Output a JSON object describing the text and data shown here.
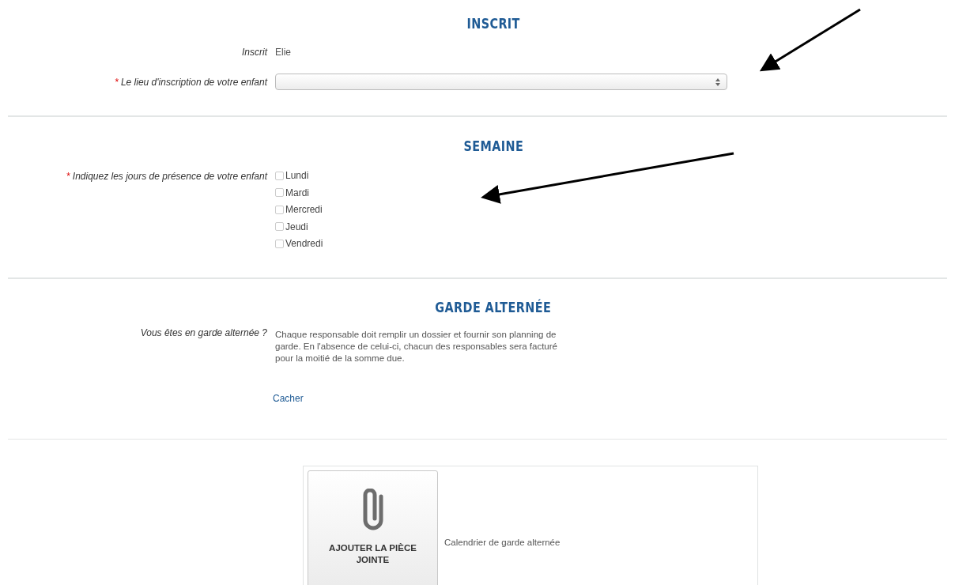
{
  "sections": [
    {
      "kind": "inscrit",
      "title": "INSCRIT",
      "fields": [
        {
          "kind": "text",
          "label": "Inscrit",
          "value": "Elie"
        },
        {
          "kind": "select",
          "label": "Le lieu d'inscription de votre enfant",
          "required_mark": "*"
        }
      ]
    },
    {
      "kind": "semaine",
      "title": "SEMAINE",
      "fields": [
        {
          "kind": "checkboxes",
          "label": "Indiquez les jours de présence de votre enfant",
          "required_mark": "*",
          "options": [
            {
              "label": "Lundi",
              "checked": false
            },
            {
              "label": "Mardi",
              "checked": false
            },
            {
              "label": "Mercredi",
              "checked": false
            },
            {
              "label": "Jeudi",
              "checked": false
            },
            {
              "label": "Vendredi",
              "checked": false
            }
          ]
        }
      ]
    },
    {
      "kind": "garde",
      "title": "GARDE ALTERNÉE",
      "fields": [
        {
          "kind": "note",
          "label": "Vous êtes en garde alternée ?",
          "value": "Chaque responsable doit remplir un dossier et fournir son planning de garde. En l'absence de celui-ci, chacun des responsables sera facturé pour la moitié de la somme due.",
          "link": "Cacher"
        }
      ]
    }
  ],
  "attachment": {
    "button": "AJOUTER LA PIÈCE JOINTE",
    "description": "Calendrier de garde alternée"
  }
}
